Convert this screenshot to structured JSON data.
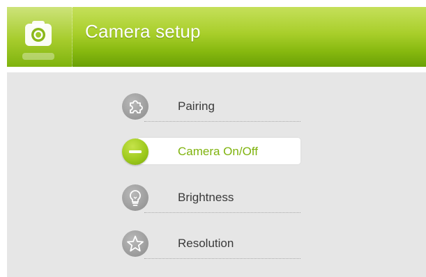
{
  "header": {
    "title": "Camera setup",
    "icon": "camera-icon"
  },
  "menu": {
    "items": [
      {
        "label": "Pairing",
        "icon": "puzzle-icon",
        "selected": false
      },
      {
        "label": "Camera On/Off",
        "icon": "minus-icon",
        "selected": true
      },
      {
        "label": "Brightness",
        "icon": "lightbulb-icon",
        "selected": false
      },
      {
        "label": "Resolution",
        "icon": "star-icon",
        "selected": false
      }
    ]
  },
  "colors": {
    "header_green": "#a8ce2a",
    "accent_green": "#7fb30e",
    "content_bg": "#e6e6e6",
    "icon_gray": "#9e9e9e"
  }
}
